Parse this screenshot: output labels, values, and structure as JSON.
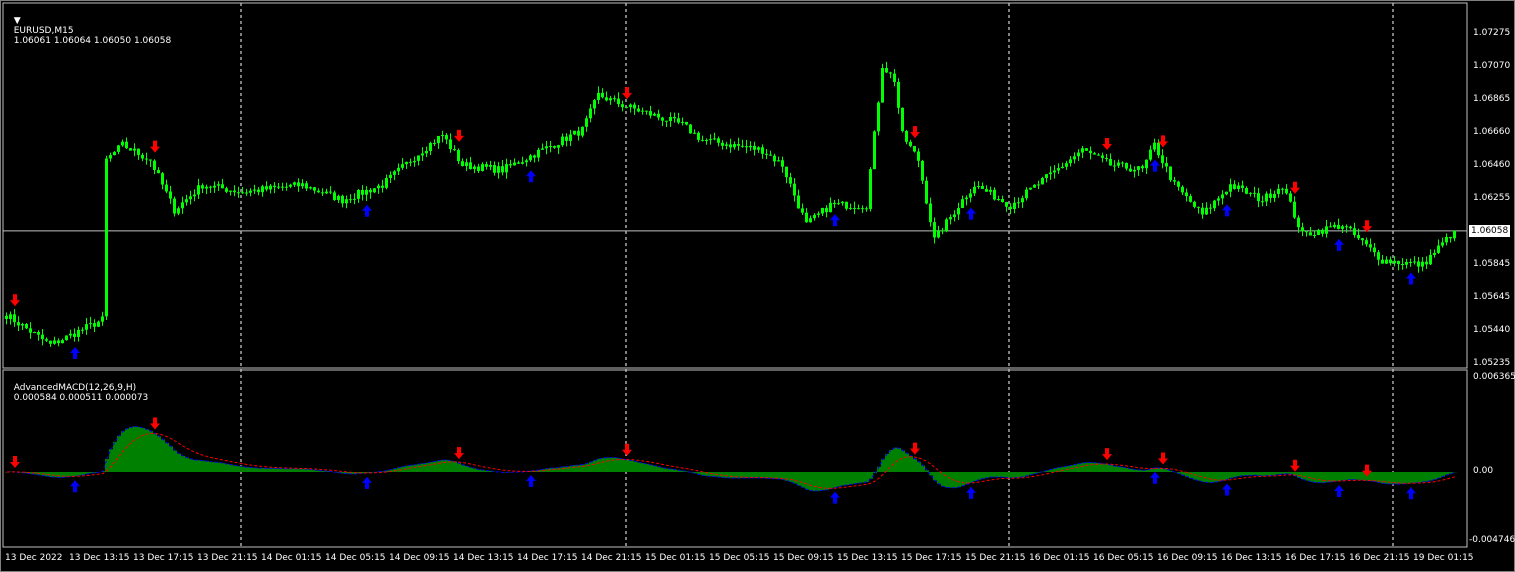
{
  "header": {
    "symbol_label": "EURUSD,M15",
    "ohlc": "1.06061 1.06064 1.06050 1.06058"
  },
  "indicator": {
    "label": "AdvancedMACD(12,26,9,H)",
    "values": "0.000584 0.000511 0.000073"
  },
  "price_axis": [
    "1.07275",
    "1.07070",
    "1.06865",
    "1.06660",
    "1.06460",
    "1.06255",
    "1.05845",
    "1.05645",
    "1.05440",
    "1.05235"
  ],
  "last_price": "1.06058",
  "macd_axis": {
    "max": "0.006365",
    "zero": "0.00",
    "min": "-0.004746"
  },
  "time_axis": [
    "13 Dec 2022",
    "13 Dec 13:15",
    "13 Dec 17:15",
    "13 Dec 21:15",
    "14 Dec 01:15",
    "14 Dec 05:15",
    "14 Dec 09:15",
    "14 Dec 13:15",
    "14 Dec 17:15",
    "14 Dec 21:15",
    "15 Dec 01:15",
    "15 Dec 05:15",
    "15 Dec 09:15",
    "15 Dec 13:15",
    "15 Dec 17:15",
    "15 Dec 21:15",
    "16 Dec 01:15",
    "16 Dec 05:15",
    "16 Dec 09:15",
    "16 Dec 13:15",
    "16 Dec 17:15",
    "16 Dec 21:15",
    "19 Dec 01:15"
  ],
  "colors": {
    "candle": "#00ff00",
    "up_arrow": "#0000ff",
    "down_arrow": "#ff0000",
    "histogram": "#008000",
    "macd_line": "#0000ff",
    "signal_line": "#ff0000",
    "grid": "#ffffff"
  },
  "chart_data": {
    "type": "candlestick",
    "timeframe": "M15",
    "price_range": [
      1.05235,
      1.07275
    ],
    "macd_range": [
      -0.004746,
      0.006365
    ],
    "close_path": [
      [
        0,
        1.05538
      ],
      [
        11,
        1.05353
      ],
      [
        24,
        1.05508
      ],
      [
        25,
        1.06496
      ],
      [
        29,
        1.06589
      ],
      [
        36,
        1.06496
      ],
      [
        42,
        1.06187
      ],
      [
        49,
        1.06342
      ],
      [
        59,
        1.06299
      ],
      [
        74,
        1.06342
      ],
      [
        84,
        1.06249
      ],
      [
        94,
        1.06342
      ],
      [
        104,
        1.06558
      ],
      [
        109,
        1.06651
      ],
      [
        114,
        1.06465
      ],
      [
        124,
        1.06435
      ],
      [
        134,
        1.06558
      ],
      [
        144,
        1.06682
      ],
      [
        148,
        1.06898
      ],
      [
        154,
        1.06836
      ],
      [
        169,
        1.06713
      ],
      [
        174,
        1.0662
      ],
      [
        189,
        1.06558
      ],
      [
        194,
        1.06465
      ],
      [
        200,
        1.06095
      ],
      [
        206,
        1.06218
      ],
      [
        215,
        1.06218
      ],
      [
        219,
        1.07083
      ],
      [
        222,
        1.06991
      ],
      [
        224,
        1.06651
      ],
      [
        228,
        1.06496
      ],
      [
        232,
        1.06002
      ],
      [
        239,
        1.06249
      ],
      [
        242,
        1.06342
      ],
      [
        251,
        1.06218
      ],
      [
        261,
        1.06404
      ],
      [
        269,
        1.06558
      ],
      [
        276,
        1.06465
      ],
      [
        284,
        1.06435
      ],
      [
        287,
        1.06589
      ],
      [
        292,
        1.06342
      ],
      [
        299,
        1.06156
      ],
      [
        306,
        1.06342
      ],
      [
        314,
        1.06249
      ],
      [
        319,
        1.06342
      ],
      [
        324,
        1.06033
      ],
      [
        334,
        1.06095
      ],
      [
        344,
        1.05878
      ],
      [
        354,
        1.05847
      ],
      [
        362,
        1.06058
      ]
    ]
  }
}
